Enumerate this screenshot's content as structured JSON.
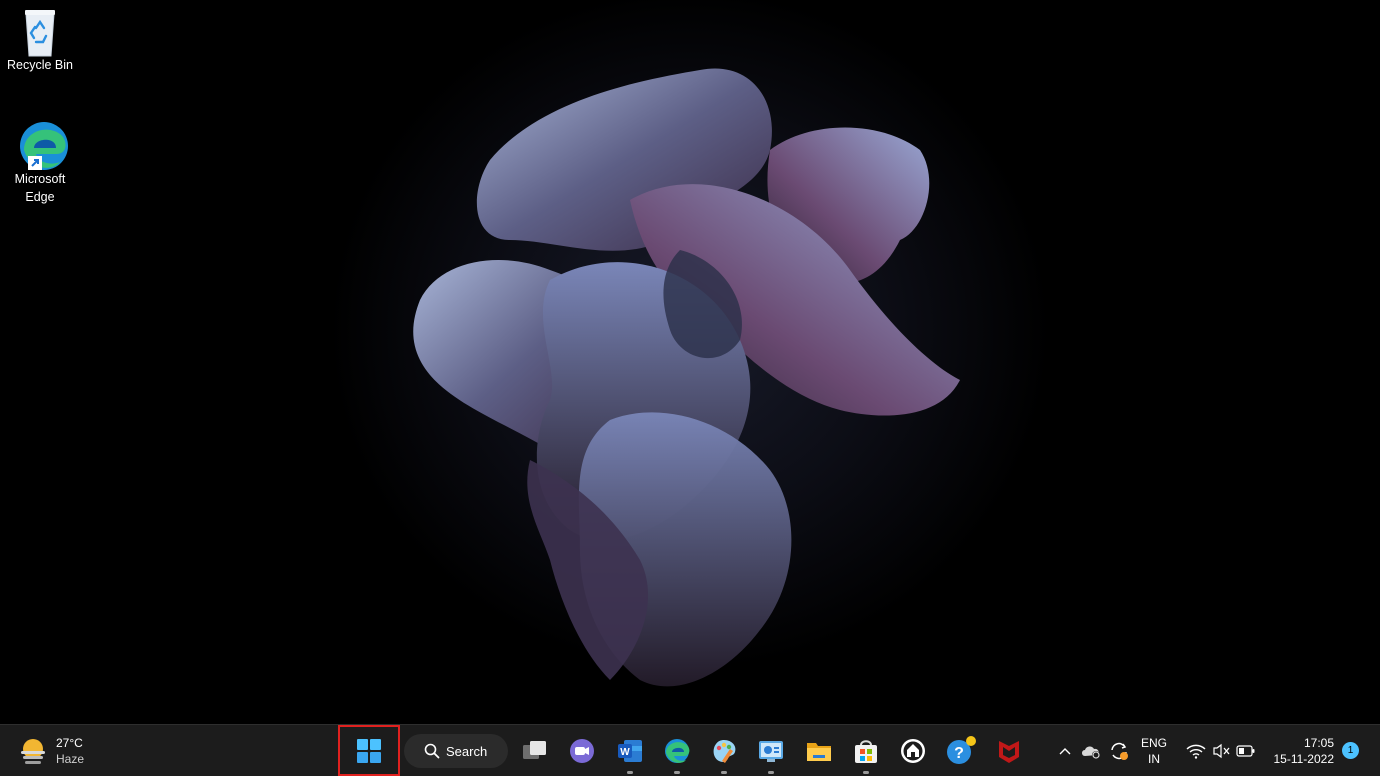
{
  "desktop": {
    "icons": [
      {
        "label": "Recycle Bin",
        "icon": "recycle-bin-icon"
      },
      {
        "label": "Microsoft\nEdge",
        "line1": "Microsoft",
        "line2": "Edge",
        "icon": "edge-icon"
      }
    ]
  },
  "taskbar": {
    "weather": {
      "temp": "27°C",
      "condition": "Haze",
      "icon": "weather-haze-icon"
    },
    "search": {
      "label": "Search"
    },
    "apps": [
      {
        "name": "task-view",
        "icon": "task-view-icon"
      },
      {
        "name": "teams-chat",
        "icon": "video-chat-icon"
      },
      {
        "name": "word",
        "icon": "word-icon",
        "running": true
      },
      {
        "name": "edge",
        "icon": "edge-icon",
        "running": true
      },
      {
        "name": "paint",
        "icon": "paint-icon",
        "running": true
      },
      {
        "name": "control-panel",
        "icon": "control-panel-icon",
        "running": true
      },
      {
        "name": "file-explorer",
        "icon": "folder-icon"
      },
      {
        "name": "microsoft-store",
        "icon": "store-icon",
        "running": true
      },
      {
        "name": "app",
        "icon": "house-icon"
      },
      {
        "name": "get-help",
        "icon": "help-icon"
      },
      {
        "name": "mcafee",
        "icon": "mcafee-icon"
      }
    ],
    "tray": {
      "language_line1": "ENG",
      "language_line2": "IN",
      "time": "17:05",
      "date": "15-11-2022",
      "notification_count": "1"
    }
  },
  "colors": {
    "accent": "#4cc2ff",
    "taskbar_bg": "#1c1c1c",
    "highlight": "#e0211f"
  }
}
